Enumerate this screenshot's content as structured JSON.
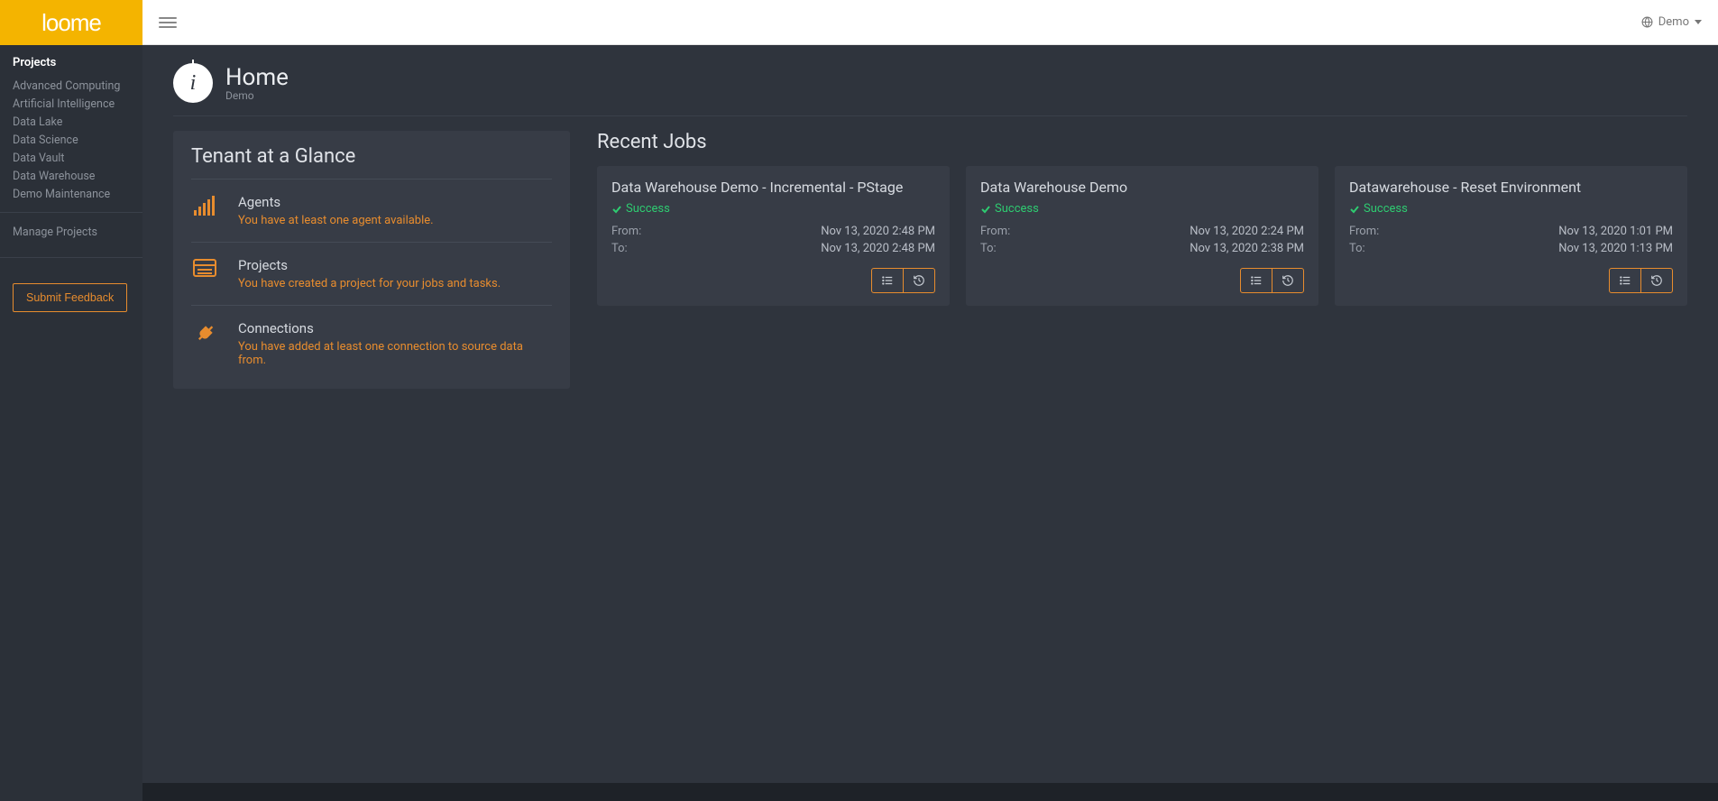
{
  "brand": "loome",
  "topbar": {
    "user_label": "Demo"
  },
  "sidebar": {
    "heading": "Projects",
    "items": [
      "Advanced Computing",
      "Artificial Intelligence",
      "Data Lake",
      "Data Science",
      "Data Vault",
      "Data Warehouse",
      "Demo Maintenance"
    ],
    "manage_label": "Manage Projects",
    "feedback_label": "Submit Feedback"
  },
  "page": {
    "title": "Home",
    "subtitle": "Demo"
  },
  "glance": {
    "title": "Tenant at a Glance",
    "rows": [
      {
        "label": "Agents",
        "desc": "You have at least one agent available."
      },
      {
        "label": "Projects",
        "desc": "You have created a project for your jobs and tasks."
      },
      {
        "label": "Connections",
        "desc": "You have added at least one connection to source data from."
      }
    ]
  },
  "recent": {
    "title": "Recent Jobs",
    "from_label": "From:",
    "to_label": "To:",
    "jobs": [
      {
        "name": "Data Warehouse Demo - Incremental - PStage",
        "status": "Success",
        "from": "Nov 13, 2020 2:48 PM",
        "to": "Nov 13, 2020 2:48 PM"
      },
      {
        "name": "Data Warehouse Demo",
        "status": "Success",
        "from": "Nov 13, 2020 2:24 PM",
        "to": "Nov 13, 2020 2:38 PM"
      },
      {
        "name": "Datawarehouse - Reset Environment",
        "status": "Success",
        "from": "Nov 13, 2020 1:01 PM",
        "to": "Nov 13, 2020 1:13 PM"
      }
    ]
  }
}
